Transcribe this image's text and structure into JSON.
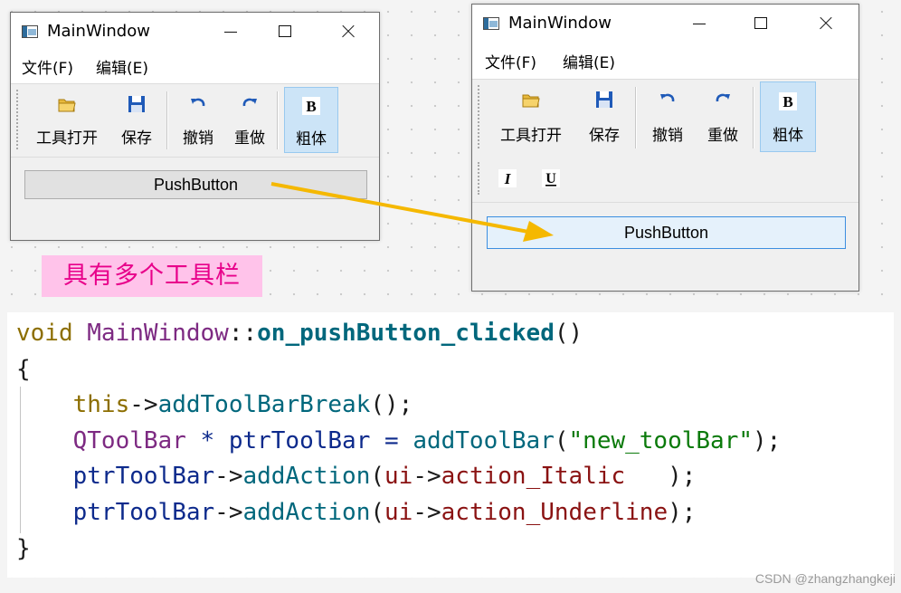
{
  "left_window": {
    "title": "MainWindow",
    "menus": [
      "文件(F)",
      "编辑(E)"
    ],
    "toolbar": [
      {
        "label": "工具打开",
        "icon": "folder-open-icon",
        "checked": false
      },
      {
        "label": "保存",
        "icon": "save-icon",
        "checked": false
      },
      {
        "label": "撤销",
        "icon": "undo-icon",
        "checked": false
      },
      {
        "label": "重做",
        "icon": "redo-icon",
        "checked": false
      },
      {
        "label": "粗体",
        "icon": "bold-icon",
        "checked": true
      }
    ],
    "push_button": "PushButton"
  },
  "right_window": {
    "title": "MainWindow",
    "menus": [
      "文件(F)",
      "编辑(E)"
    ],
    "toolbar": [
      {
        "label": "工具打开",
        "icon": "folder-open-icon",
        "checked": false
      },
      {
        "label": "保存",
        "icon": "save-icon",
        "checked": false
      },
      {
        "label": "撤销",
        "icon": "undo-icon",
        "checked": false
      },
      {
        "label": "重做",
        "icon": "redo-icon",
        "checked": false
      },
      {
        "label": "粗体",
        "icon": "bold-icon",
        "checked": true
      }
    ],
    "second_toolbar": [
      {
        "icon": "italic-icon",
        "glyph": "I"
      },
      {
        "icon": "underline-icon",
        "glyph": "U"
      }
    ],
    "push_button": "PushButton"
  },
  "annotation": "具有多个工具栏",
  "code": {
    "line1": {
      "kw": "void",
      "cls": "MainWindow",
      "sep": "::",
      "fn": "on_pushButton_clicked",
      "paren": "()"
    },
    "line2": "{",
    "line3": {
      "indent": "    ",
      "this": "this",
      "arrow": "->",
      "call": "addToolBarBreak",
      "rest": "();"
    },
    "line4": {
      "indent": "    ",
      "type": "QToolBar",
      "mid": " * ptrToolBar = ",
      "call": "addToolBar",
      "open": "(",
      "str": "\"new_toolBar\"",
      "close": ");"
    },
    "line5": {
      "indent": "    ",
      "var": "ptrToolBar",
      "arrow": "->",
      "call": "addAction",
      "open": "(",
      "ui": "ui",
      "arrow2": "->",
      "member": "action_Italic",
      "close": "   );"
    },
    "line6": {
      "indent": "    ",
      "var": "ptrToolBar",
      "arrow": "->",
      "call": "addAction",
      "open": "(",
      "ui": "ui",
      "arrow2": "->",
      "member": "action_Underline",
      "close": ");"
    },
    "line7": "}"
  },
  "watermark": "CSDN @zhangzhangkeji",
  "colors": {
    "arrow": "#f5b800",
    "pink_label_bg": "#ffc3ea",
    "pink_label_text": "#e8008a",
    "checked_button_bg": "#cce4f7",
    "focused_button_border": "#3c8ee0"
  }
}
